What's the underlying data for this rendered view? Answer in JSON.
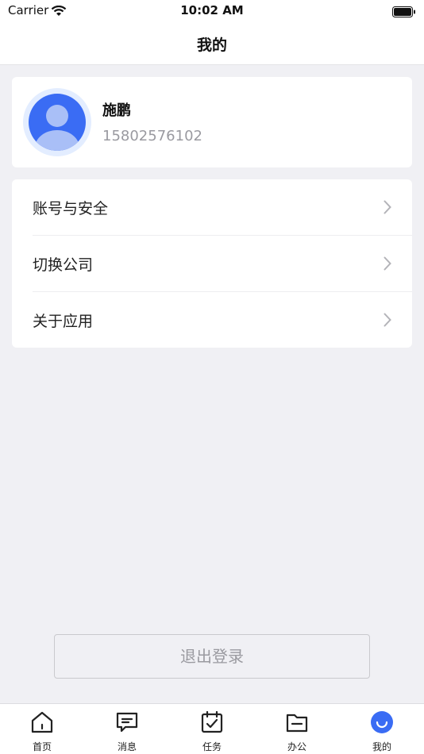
{
  "status_bar": {
    "carrier": "Carrier",
    "time": "10:02 AM"
  },
  "nav": {
    "title": "我的"
  },
  "profile": {
    "name": "施鹏",
    "phone": "15802576102"
  },
  "menu": {
    "items": [
      {
        "label": "账号与安全"
      },
      {
        "label": "切换公司"
      },
      {
        "label": "关于应用"
      }
    ]
  },
  "logout": {
    "label": "退出登录"
  },
  "tab_bar": {
    "tabs": [
      {
        "label": "首页",
        "icon": "home-icon"
      },
      {
        "label": "消息",
        "icon": "message-icon"
      },
      {
        "label": "任务",
        "icon": "calendar-check-icon"
      },
      {
        "label": "办公",
        "icon": "folder-icon"
      },
      {
        "label": "我的",
        "icon": "profile-icon",
        "active": true
      }
    ]
  },
  "colors": {
    "accent": "#3a6cf4",
    "background": "#f0f0f4",
    "secondary_text": "#9a9aa0"
  }
}
